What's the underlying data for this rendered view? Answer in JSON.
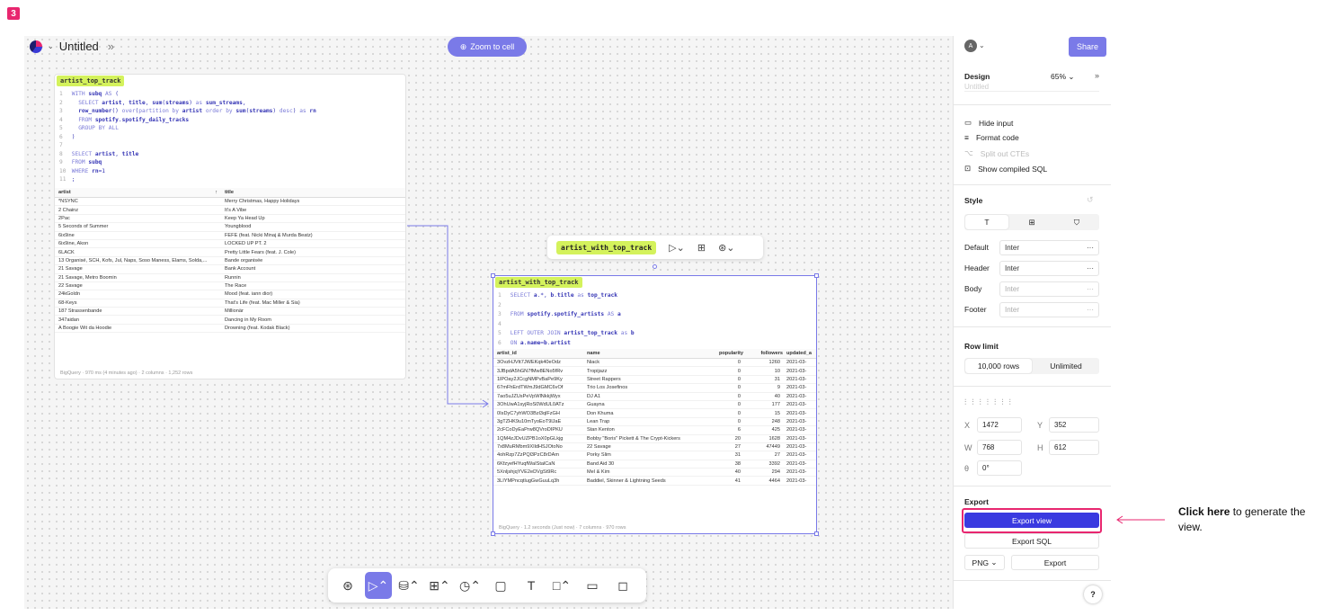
{
  "step_number": "3",
  "header": {
    "title": "Untitled",
    "zoom_button": "Zoom to cell"
  },
  "cell1": {
    "name": "artist_top_track",
    "code": [
      {
        "n": "1",
        "t": "WITH subq AS ("
      },
      {
        "n": "2",
        "t": "  SELECT artist, title, sum(streams) as sum_streams,"
      },
      {
        "n": "3",
        "t": "  row_number() over(partition by artist order by sum(streams) desc) as rn"
      },
      {
        "n": "4",
        "t": "  FROM spotify.spotify_daily_tracks"
      },
      {
        "n": "5",
        "t": "  GROUP BY ALL"
      },
      {
        "n": "6",
        "t": ")"
      },
      {
        "n": "7",
        "t": ""
      },
      {
        "n": "8",
        "t": "SELECT artist, title"
      },
      {
        "n": "9",
        "t": "FROM subq"
      },
      {
        "n": "10",
        "t": "WHERE rn=1"
      },
      {
        "n": "11",
        "t": ";"
      }
    ],
    "columns": [
      "artist",
      "title"
    ],
    "sort_indicator": "↑",
    "rows": [
      [
        "*NSYNC",
        "Merry Christmas, Happy Holidays"
      ],
      [
        "2 Chainz",
        "It's A Vibe"
      ],
      [
        "2Pac",
        "Keep Ya Head Up"
      ],
      [
        "5 Seconds of Summer",
        "Youngblood"
      ],
      [
        "6ix9ine",
        "FEFE (feat. Nicki Minaj & Murda Beatz)"
      ],
      [
        "6ix9ine, Akon",
        "LOCKED UP PT. 2"
      ],
      [
        "6LACK",
        "Pretty Little Fears (feat. J. Cole)"
      ],
      [
        "13 Organisé, SCH, Kofs, Jul, Naps, Soso Maness, Elams, Solda,...",
        "Bande organisée"
      ],
      [
        "21 Savage",
        "Bank Account"
      ],
      [
        "21 Savage, Metro Boomin",
        "Runnin"
      ],
      [
        "22 Savage",
        "The Race"
      ],
      [
        "24kGoldn",
        "Mood (feat. iann dior)"
      ],
      [
        "68-Keys",
        "That's Life (feat. Mac Miller & Sia)"
      ],
      [
        "187 Strassenbande",
        "Millionär"
      ],
      [
        "347aidan",
        "Dancing in My Room"
      ],
      [
        "A Boogie Wit da Hoodie",
        "Drowning (feat. Kodak Black)"
      ]
    ],
    "footer": "BigQuery · 970 ms (4 minutes ago) · 2 columns · 1,252 rows"
  },
  "cell2": {
    "name": "artist_with_top_track",
    "code": [
      {
        "n": "1",
        "t": "SELECT a.*, b.title as top_track"
      },
      {
        "n": "2",
        "t": ""
      },
      {
        "n": "3",
        "t": "FROM spotify.spotify_artists AS a"
      },
      {
        "n": "4",
        "t": ""
      },
      {
        "n": "5",
        "t": "LEFT OUTER JOIN artist_top_track as b"
      },
      {
        "n": "6",
        "t": "ON a.name=b.artist"
      }
    ],
    "columns": [
      "artist_id",
      "name",
      "popularity",
      "followers",
      "updated_a"
    ],
    "rows": [
      [
        "3OvzHJVtt7JWEKqk40eOdz",
        "Niack",
        "0",
        "1260",
        "2021-03-"
      ],
      [
        "3JBpdA5hGN7fMw8ENo5fRv",
        "Tropijazz",
        "0",
        "10",
        "2021-03-"
      ],
      [
        "1lPOay2JCcgNMPvBaPe9Ky",
        "Street Rappers",
        "0",
        "31",
        "2021-03-"
      ],
      [
        "67mFhErdTWmJ9dGMC6vOf",
        "Trio Los Josefinos",
        "0",
        "9",
        "2021-03-"
      ],
      [
        "7ao5uJZUsPeVpWlNkkjWyx",
        "DJ A1",
        "0",
        "40",
        "2021-03-"
      ],
      [
        "3OhUwA1syjRoS0WdUL0ATz",
        "Guayna",
        "0",
        "177",
        "2021-03-"
      ],
      [
        "0IsDyC7yhWO3Bzl3qlFzGH",
        "Don Khuma",
        "0",
        "15",
        "2021-03-"
      ],
      [
        "3gTZHK9u10mTyoEoT9lJaE",
        "Lean Trap",
        "0",
        "248",
        "2021-03-"
      ],
      [
        "2cFCoDyEaPrw8QVroDIPKU",
        "Stan Kenton",
        "6",
        "425",
        "2021-03-"
      ],
      [
        "1QM4zJDvUZPB1oX0pGLkjg",
        "Bobby \"Boris\" Pickett & The Crypt-Kickers",
        "20",
        "1628",
        "2021-03-"
      ],
      [
        "7x8MuRMbm9XIldHSJOtoNo",
        "22 Savage",
        "27",
        "47449",
        "2021-03-"
      ],
      [
        "4ohRzp7ZzPQl3PzC8rDAm",
        "Porky Slim",
        "31",
        "27",
        "2021-03-"
      ],
      [
        "6KfzyefHYuqfWaIStalCaN",
        "Band Aid 30",
        "38",
        "3392",
        "2021-03-"
      ],
      [
        "5XnljshjqYVE2eDVgSt9Rc",
        "Mel & Kim",
        "40",
        "294",
        "2021-03-"
      ],
      [
        "3LIYMPncqtlugGwGuuLq3h",
        "Baddiel, Skinner & Lightning Seeds",
        "41",
        "4464",
        "2021-03-"
      ]
    ],
    "footer": "BigQuery · 1.2 seconds (Just now) · 7 columns · 970 rows"
  },
  "panel": {
    "avatar": "A",
    "share": "Share",
    "design": "Design",
    "zoom": "65%",
    "name_value": "Untitled",
    "actions": [
      "Hide input",
      "Format code",
      "Split out CTEs",
      "Show compiled SQL"
    ],
    "style": "Style",
    "fonts": [
      {
        "label": "Default",
        "value": "Inter"
      },
      {
        "label": "Header",
        "value": "Inter"
      },
      {
        "label": "Body",
        "value": "Inter"
      },
      {
        "label": "Footer",
        "value": "Inter"
      }
    ],
    "row_limit": "Row limit",
    "row_limit_options": [
      "10,000 rows",
      "Unlimited"
    ],
    "position": {
      "x_label": "X",
      "x": "1472",
      "y_label": "Y",
      "y": "352",
      "w_label": "W",
      "w": "768",
      "h_label": "H",
      "h": "612",
      "rot_label": "θ",
      "rot": "0°"
    },
    "export": "Export",
    "export_view": "Export view",
    "export_sql": "Export SQL",
    "format": "PNG",
    "export_btn": "Export",
    "help": "?"
  },
  "callout": {
    "bold": "Click here",
    "rest": " to generate the view."
  },
  "colors": {
    "accent": "#7a7ae8",
    "highlight": "#e8266f",
    "tag": "#d4f25c",
    "export": "#3a3ae0"
  }
}
